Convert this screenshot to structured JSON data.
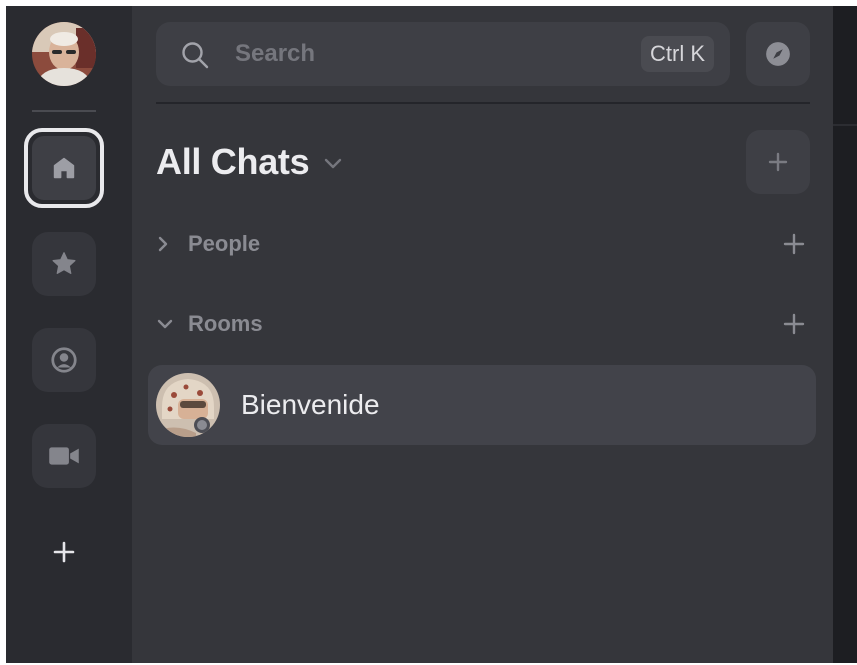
{
  "rail": {
    "user_avatar": "user-avatar",
    "items": [
      {
        "name": "home",
        "icon": "home-icon",
        "active": true
      },
      {
        "name": "favourites",
        "icon": "star-icon",
        "active": false
      },
      {
        "name": "people",
        "icon": "person-circle-icon",
        "active": false
      },
      {
        "name": "video",
        "icon": "video-camera-icon",
        "active": false
      }
    ],
    "add_icon": "plus-icon"
  },
  "search": {
    "placeholder": "Search",
    "shortcut": "Ctrl K",
    "icon": "search-icon"
  },
  "explore": {
    "icon": "compass-icon"
  },
  "header": {
    "title": "All Chats",
    "menu_icon": "chevron-down-icon",
    "add_icon": "plus-icon"
  },
  "sections": [
    {
      "label": "People",
      "expanded": false
    },
    {
      "label": "Rooms",
      "expanded": true
    }
  ],
  "rooms": [
    {
      "name": "Bienvenide",
      "selected": true
    }
  ],
  "colors": {
    "panel": "#35363b",
    "rail": "#2a2b30",
    "selected_row": "#42434a",
    "accent_text": "#ececef",
    "muted_text": "#8a8b92"
  }
}
